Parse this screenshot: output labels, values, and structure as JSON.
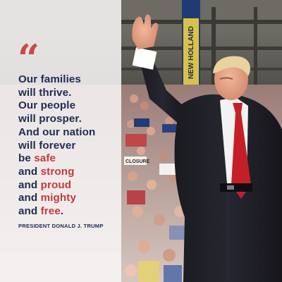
{
  "quote_mark": "“",
  "quote": {
    "line1": "Our families",
    "line2": "will thrive.",
    "line3": "Our people",
    "line4": "will prosper.",
    "line5": "And our nation",
    "line6": "will forever",
    "line7_prefix": "be ",
    "line7_accent": "safe",
    "line8_prefix": "and ",
    "line8_accent": "strong",
    "line9_prefix": "and ",
    "line9_accent": "proud",
    "line10_prefix": "and ",
    "line10_accent": "mighty",
    "line11_prefix": "and ",
    "line11_accent": "free",
    "line11_suffix": "."
  },
  "attribution": "PRESIDENT DONALD J. TRUMP",
  "banner_text": "NEW HOLLAND",
  "sign_text": "CLOSURE",
  "colors": {
    "navy": "#1e2b54",
    "red": "#c43a3d",
    "quote_mark": "#c9484a"
  }
}
